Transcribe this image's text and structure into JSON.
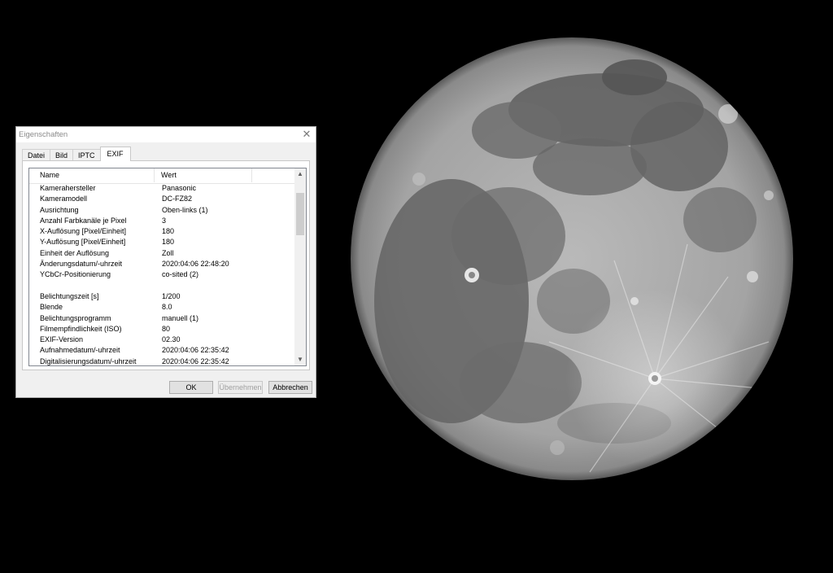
{
  "window": {
    "title": "Eigenschaften",
    "close_glyph": "✕"
  },
  "tabs": [
    {
      "label": "Datei",
      "active": false
    },
    {
      "label": "Bild",
      "active": false
    },
    {
      "label": "IPTC",
      "active": false
    },
    {
      "label": "EXIF",
      "active": true
    }
  ],
  "list": {
    "header_name": "Name",
    "header_value": "Wert",
    "rows": [
      {
        "name": "Kamerahersteller",
        "value": "Panasonic"
      },
      {
        "name": "Kameramodell",
        "value": "DC-FZ82"
      },
      {
        "name": "Ausrichtung",
        "value": "Oben-links (1)"
      },
      {
        "name": "Anzahl Farbkanäle je Pixel",
        "value": "3"
      },
      {
        "name": "X-Auflösung [Pixel/Einheit]",
        "value": "180"
      },
      {
        "name": "Y-Auflösung [Pixel/Einheit]",
        "value": "180"
      },
      {
        "name": "Einheit der Auflösung",
        "value": "Zoll"
      },
      {
        "name": "Änderungsdatum/-uhrzeit",
        "value": "2020:04:06 22:48:20"
      },
      {
        "name": "YCbCr-Positionierung",
        "value": "co-sited (2)"
      },
      {
        "name": "",
        "value": ""
      },
      {
        "name": "Belichtungszeit [s]",
        "value": "1/200"
      },
      {
        "name": "Blende",
        "value": "8.0"
      },
      {
        "name": "Belichtungsprogramm",
        "value": "manuell (1)"
      },
      {
        "name": "Filmempfindlichkeit (ISO)",
        "value": "80"
      },
      {
        "name": "EXIF-Version",
        "value": "02.30"
      },
      {
        "name": "Aufnahmedatum/-uhrzeit",
        "value": "2020:04:06 22:35:42"
      },
      {
        "name": "Digitalisierungsdatum/-uhrzeit",
        "value": "2020:04:06 22:35:42"
      }
    ],
    "scroll_up_glyph": "▲",
    "scroll_down_glyph": "▼"
  },
  "buttons": {
    "ok": "OK",
    "apply": "Übernehmen",
    "cancel": "Abbrechen"
  },
  "icons": {
    "close": "close-icon",
    "scroll_up": "chevron-up-icon",
    "scroll_down": "chevron-down-icon"
  }
}
